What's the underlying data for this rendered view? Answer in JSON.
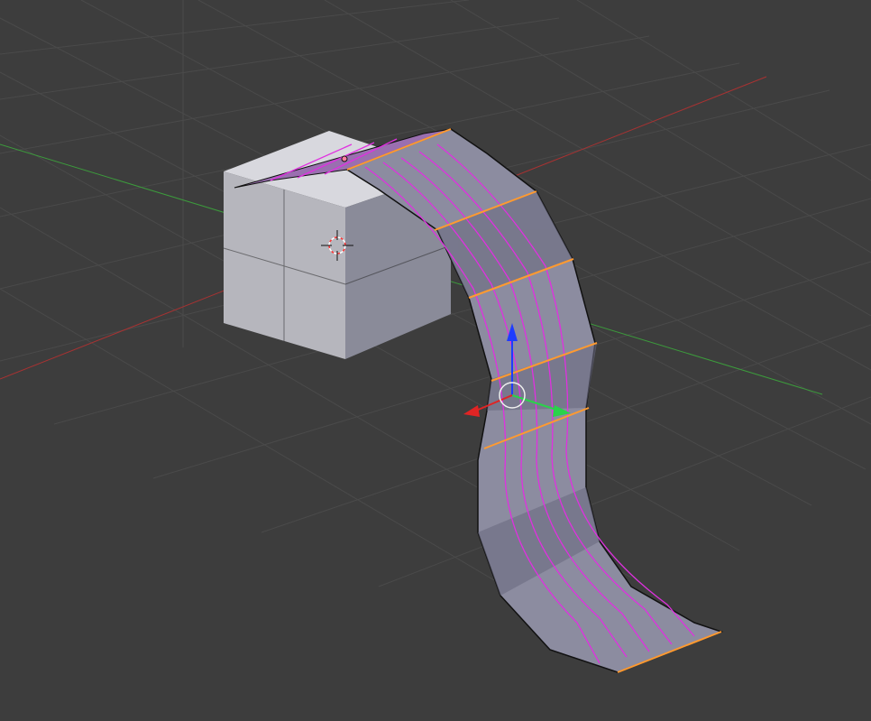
{
  "viewport": {
    "name": "3D Viewport",
    "mode": "edit",
    "background": "#3d3d3d",
    "grid_color": "#4a4a4a",
    "axis_x_color": "#a83232",
    "axis_y_color": "#3c9a3c"
  },
  "objects": {
    "cube": {
      "name": "cube",
      "face_top": "#d8d8de",
      "face_front": "#b6b6bd",
      "face_side": "#8a8b99"
    },
    "strip": {
      "name": "curved-strip-mesh",
      "fill": "#8c8ca0",
      "selected_edge": "#ff9a30",
      "seam_edge": "#e030e0"
    }
  },
  "gizmo": {
    "z_color": "#1e3cff",
    "y_color": "#2ad24a",
    "x_color": "#e02424",
    "pivot_color": "#f0f0f0"
  },
  "cursor_3d": {
    "ring_primary": "#ffffff",
    "ring_secondary": "#ff3333"
  }
}
